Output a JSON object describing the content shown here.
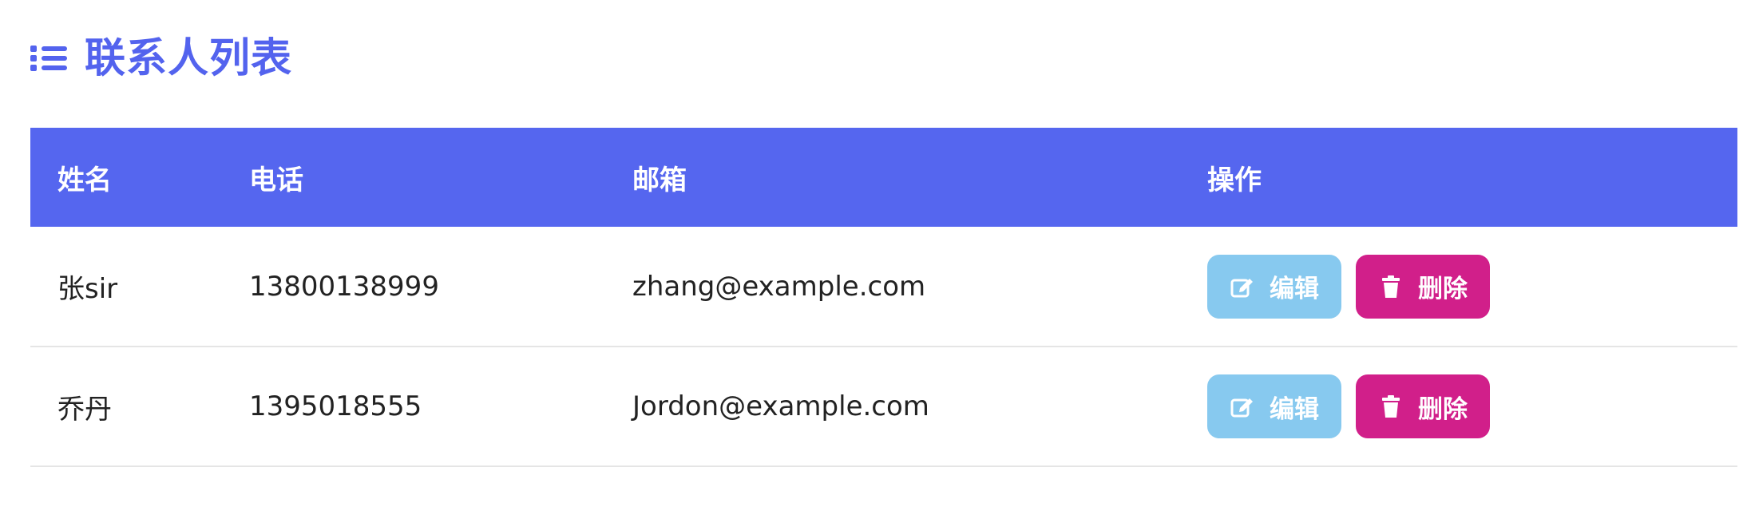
{
  "header": {
    "title": "联系人列表",
    "icon": "list-icon",
    "accent_color": "#5363ee"
  },
  "table": {
    "columns": [
      "姓名",
      "电话",
      "邮箱",
      "操作"
    ],
    "rows": [
      {
        "name": "张sir",
        "phone": "13800138999",
        "email": "zhang@example.com",
        "edit_label": "编辑",
        "delete_label": "删除"
      },
      {
        "name": "乔丹",
        "phone": "1395018555",
        "email": "Jordon@example.com",
        "edit_label": "编辑",
        "delete_label": "删除"
      }
    ],
    "header_color": "#5566ef",
    "edit_color": "#87c9ef",
    "delete_color": "#d11f8a",
    "edit_icon": "edit-icon",
    "delete_icon": "trash-icon"
  }
}
